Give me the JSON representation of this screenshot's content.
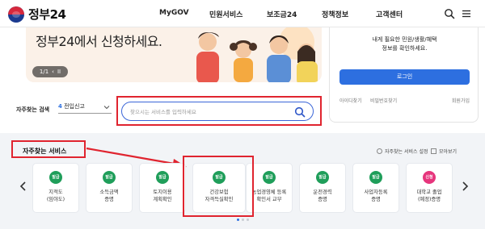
{
  "header": {
    "logo_text": "정부24",
    "nav": [
      "MyGOV",
      "민원서비스",
      "보조금24",
      "정책정보",
      "고객센터"
    ],
    "icons": [
      "search-icon",
      "menu-icon"
    ]
  },
  "hero": {
    "title": "정부24에서 신청하세요.",
    "pager_text": "1/1",
    "pager_prev": "‹",
    "pager_pause": "II"
  },
  "login": {
    "desc_line1": "내게 필요한 민원/생활/혜택",
    "desc_line2": "정보를 확인하세요.",
    "button": "로그인",
    "find_id": "아이디찾기",
    "find_pw": "비밀번호찾기",
    "signup": "회원가입"
  },
  "search": {
    "freq_label": "자주찾는 검색",
    "freq_select_num": "4",
    "freq_select_text": "전입신고",
    "placeholder": "찾으시는 서비스를 입력하세요"
  },
  "services": {
    "title": "자주찾는 서비스",
    "settings": "자주찾는 서비스 설정",
    "view_all": "모아보기",
    "items": [
      {
        "badge": "발급",
        "color": "#1f9e5a",
        "line1": "지적도",
        "line2": "(임야도)"
      },
      {
        "badge": "발급",
        "color": "#1f9e5a",
        "line1": "소득금액",
        "line2": "증명"
      },
      {
        "badge": "발급",
        "color": "#1f9e5a",
        "line1": "토지이용",
        "line2": "계획확인"
      },
      {
        "badge": "발급",
        "color": "#1f9e5a",
        "line1": "건강보험",
        "line2": "자격득실확인"
      },
      {
        "badge": "발급",
        "color": "#1f9e5a",
        "line1": "농업경영체 등록",
        "line2": "확인서 교부"
      },
      {
        "badge": "발급",
        "color": "#1f9e5a",
        "line1": "운전경력",
        "line2": "증명"
      },
      {
        "badge": "발급",
        "color": "#1f9e5a",
        "line1": "사업자등록",
        "line2": "증명"
      },
      {
        "badge": "신청",
        "color": "#e6357c",
        "line1": "대학교 졸업",
        "line2": "(예정)증명"
      }
    ]
  },
  "colors": {
    "accent": "#2d6fe0",
    "highlight": "#e0242f",
    "issue_badge": "#1f9e5a",
    "apply_badge": "#e6357c"
  }
}
